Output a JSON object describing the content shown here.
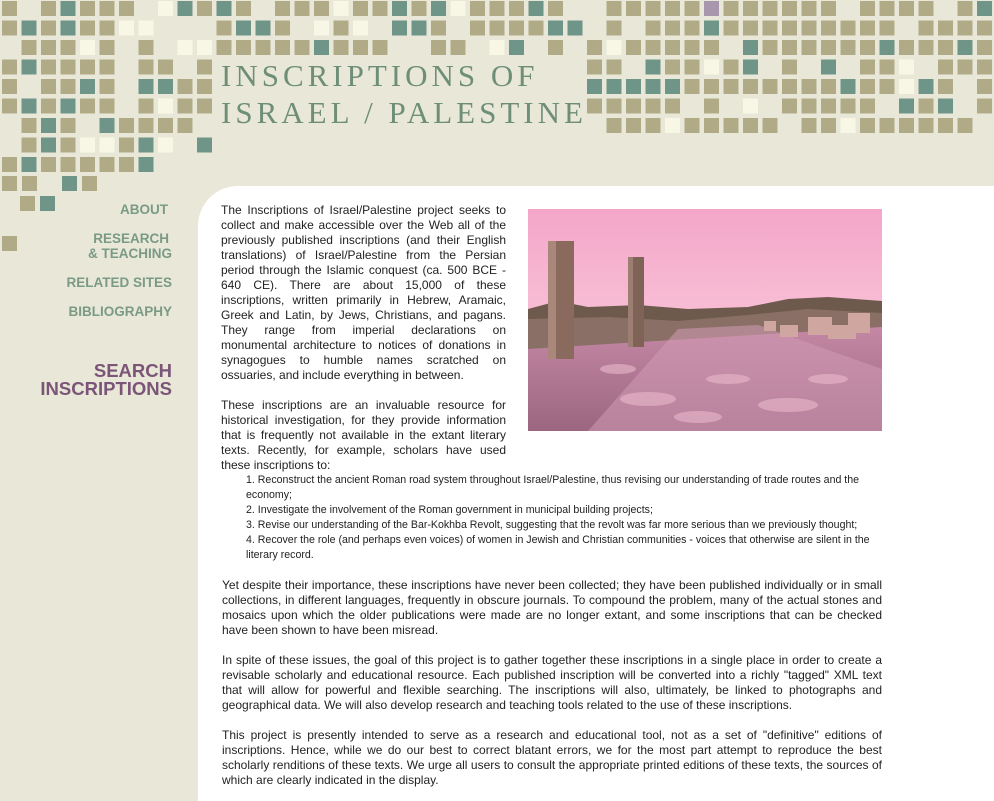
{
  "site": {
    "title_line1": "INSCRIPTIONS OF",
    "title_line2": "ISRAEL / PALESTINE"
  },
  "nav": {
    "about": "ABOUT",
    "research_line1": "RESEARCH",
    "research_line2": "& TEACHING",
    "related_sites": "RELATED SITES",
    "bibliography": "BIBLIOGRAPHY",
    "search_line1": "SEARCH",
    "search_line2": "INSCRIPTIONS"
  },
  "content": {
    "intro": "The Inscriptions of Israel/Palestine project seeks to collect and make accessible over the Web all of the previously published inscriptions (and their English translations) of Israel/Palestine from the Persian period through the Islamic conquest (ca. 500 BCE - 640 CE). There are about 15,000 of these inscriptions, written primarily in Hebrew, Aramaic, Greek and Latin, by Jews, Christians, and pagans. They range from imperial declarations on monumental architecture to notices of donations in synagogues to humble names scratched on ossuaries, and include everything in between.",
    "resource": "These inscriptions are an invaluable resource for historical investigation, for they provide information that is frequently not available in the extant literary texts. Recently, for example, scholars have used these inscriptions to:",
    "uses": [
      "1. Reconstruct the ancient Roman road system throughout Israel/Palestine, thus revising our understanding of trade routes and the economy;",
      "2. Investigate the involvement of the Roman government in municipal building projects;",
      "3. Revise our understanding of the Bar-Kokhba Revolt, suggesting that the revolt was far more serious than we previously thought;",
      "4. Recover the role (and perhaps even voices) of women in Jewish and Christian communities - voices that otherwise are silent in the literary record."
    ],
    "never_collected": "Yet despite their importance, these inscriptions have never been collected; they have been published individually or in small collections, in different languages, frequently in obscure journals. To compound the problem, many of the actual stones and mosaics upon which the older publications were made are no longer extant, and some inscriptions that can be checked have been shown to have been misread.",
    "goal": "In spite of these issues, the goal of this project is to gather together these inscriptions in a single place in order to create a revisable scholarly and educational resource. Each published inscription will be converted into a richly \"tagged\" XML text that will allow for powerful and flexible searching. The inscriptions will also, ultimately, be linked to photographs and geographical data. We will also develop research and teaching tools related to the use of these inscriptions.",
    "disclaimer": "This project is presently intended to serve as a research and educational tool, not as a set of \"definitive\" editions of inscriptions. Hence, while we do our best to correct blatant errors, we for the most part attempt to reproduce the best scholarly renditions of these texts. We urge all users to consult the appropriate printed editions of these texts, the sources of which are clearly indicated in the display."
  },
  "colors": {
    "background": "#e9e8d8",
    "tile_olive": "#b0ab86",
    "tile_teal": "#6f9488",
    "tile_mauve": "#a896ad",
    "tile_cream": "#f8f7e6",
    "title": "#6e8e78",
    "nav": "#7a9a86",
    "search": "#7a5577"
  },
  "icons": {
    "photo": "roman-road-ruins-photo"
  }
}
